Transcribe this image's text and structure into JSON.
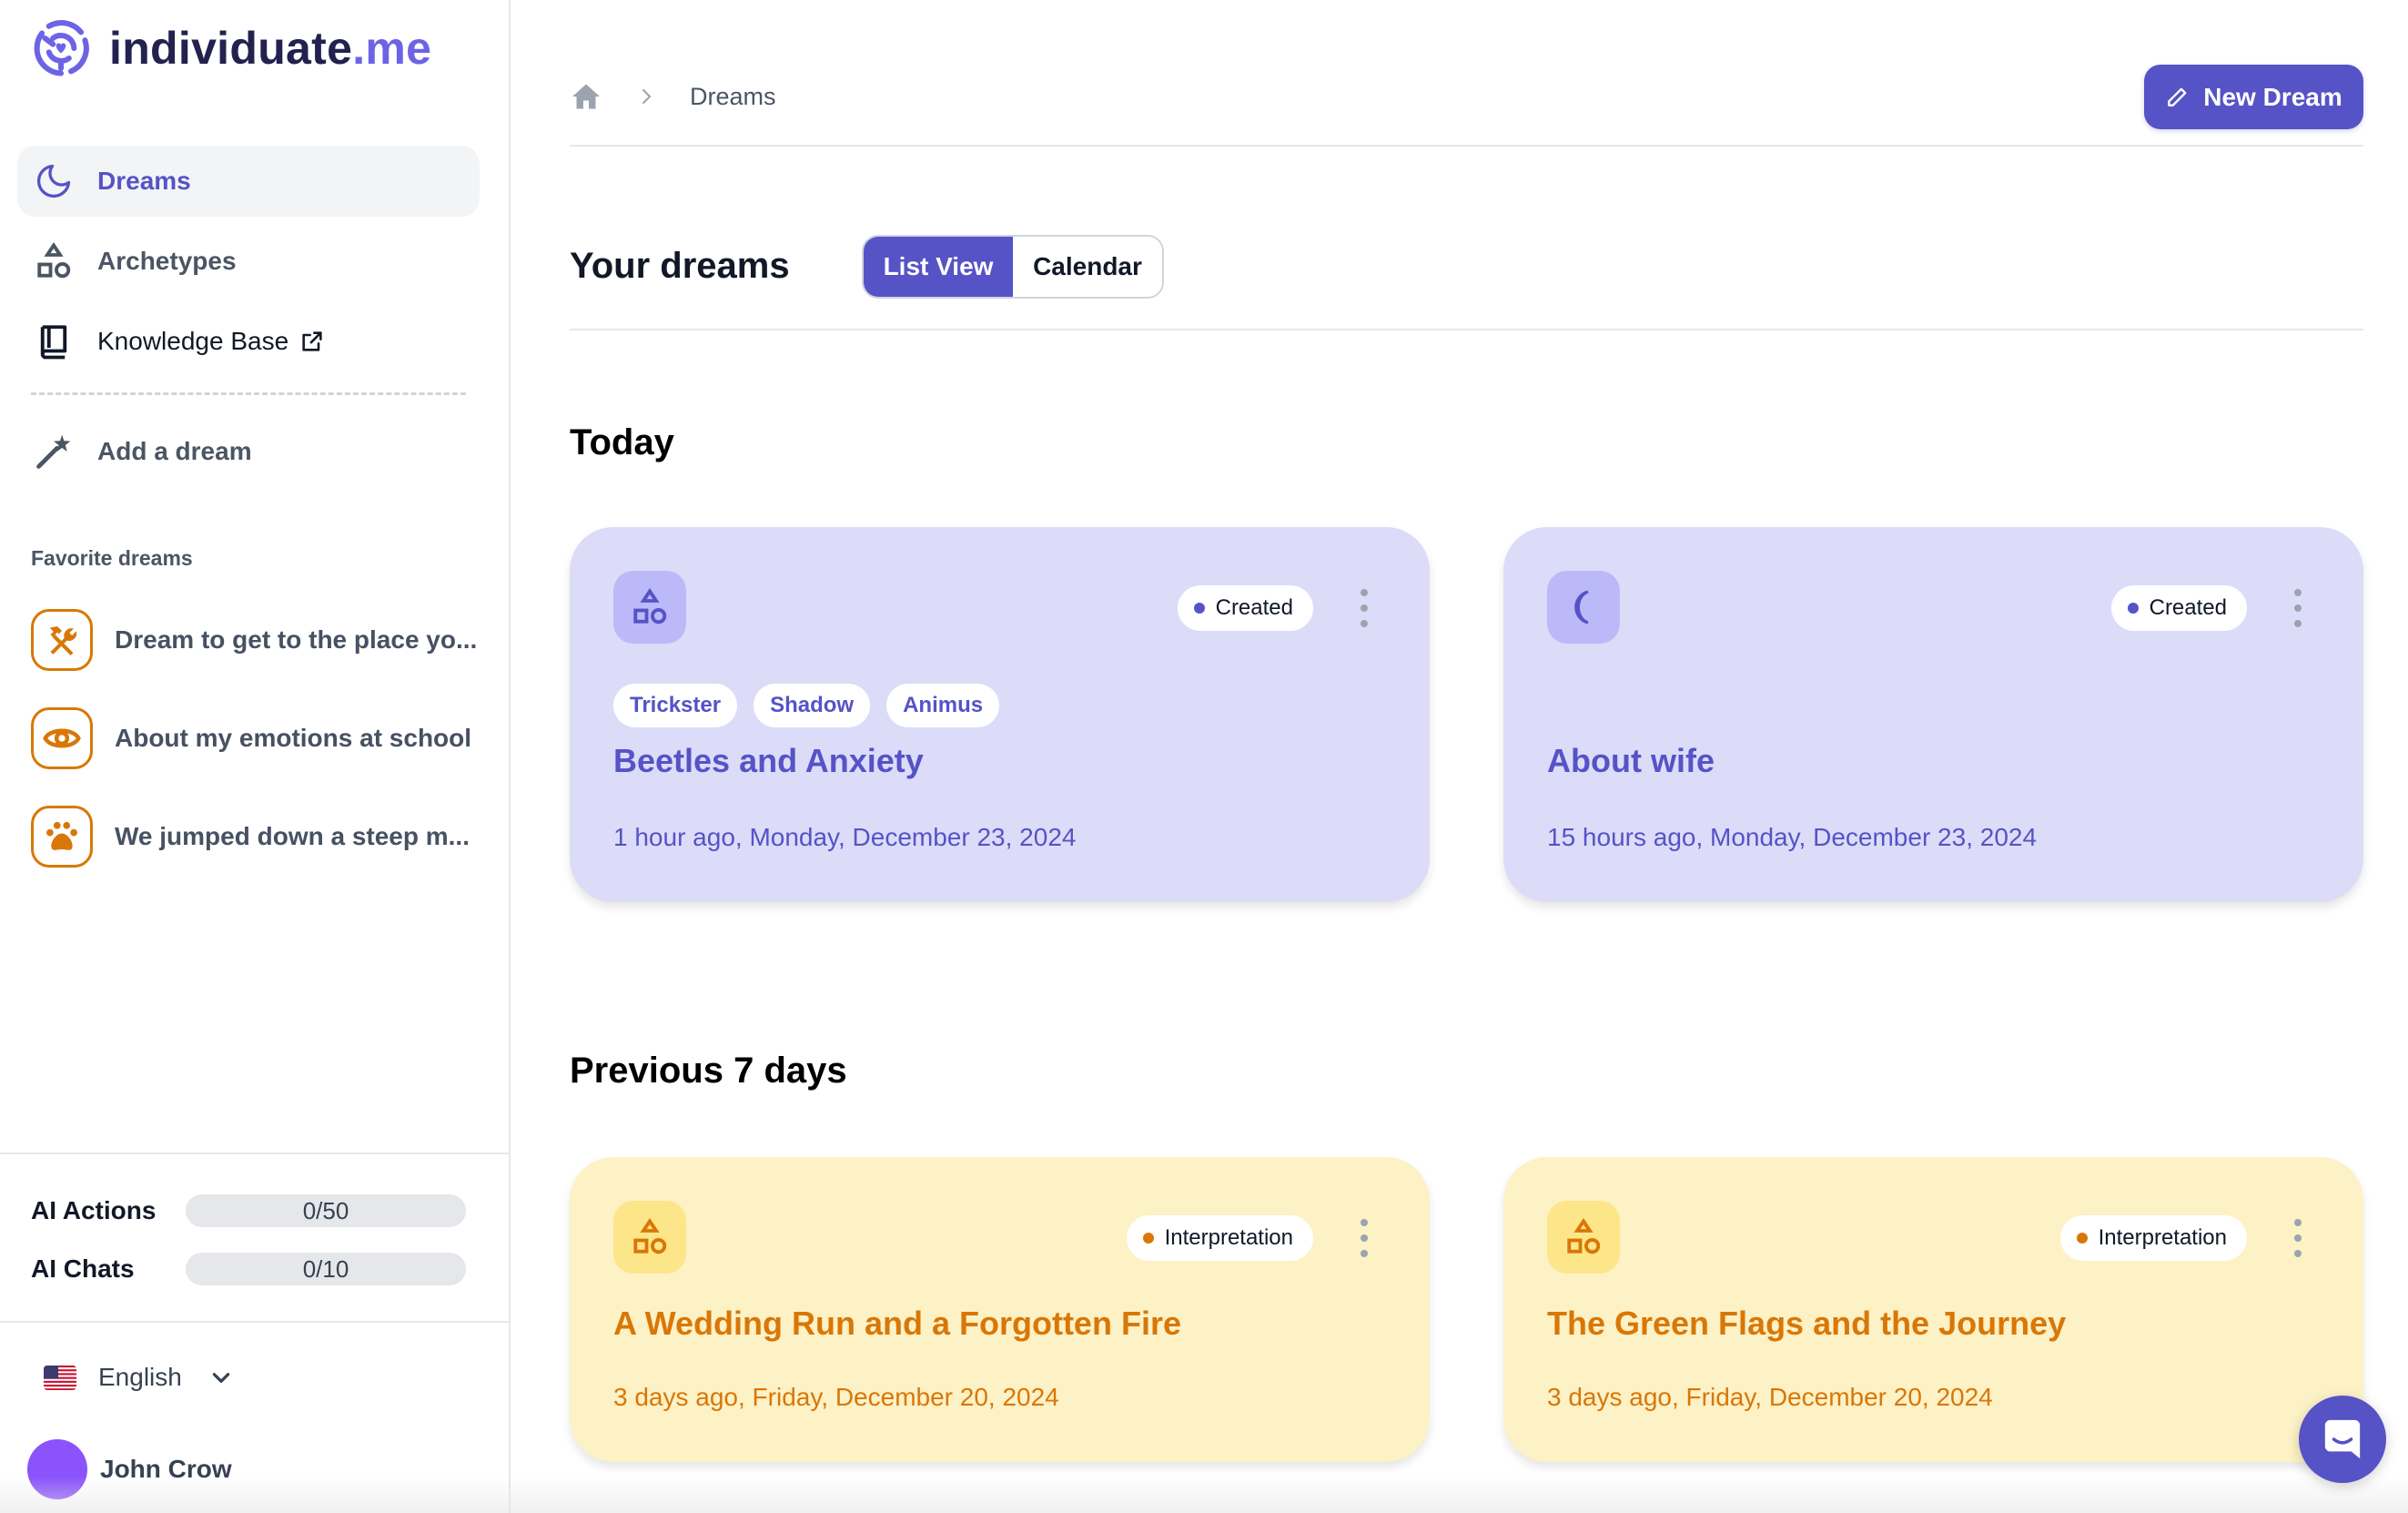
{
  "app": {
    "brand_name": "individuate",
    "brand_suffix": ".me",
    "accent_color": "#5553c6"
  },
  "sidebar": {
    "nav": [
      {
        "label": "Dreams",
        "icon": "moon-icon",
        "active": true
      },
      {
        "label": "Archetypes",
        "icon": "shapes-icon",
        "active": false
      },
      {
        "label": "Knowledge Base",
        "icon": "book-icon",
        "external": true,
        "active": false
      },
      {
        "label": "Add a dream",
        "icon": "magic-wand-icon",
        "active": false
      }
    ],
    "favorites_title": "Favorite dreams",
    "favorites": [
      {
        "label": "Dream to get to the place yo...",
        "icon": "tools-icon"
      },
      {
        "label": "About my emotions at school",
        "icon": "eye-icon"
      },
      {
        "label": "We jumped down a steep m...",
        "icon": "paw-icon"
      }
    ],
    "quotas": [
      {
        "label": "AI Actions",
        "text": "0/50",
        "used": 0,
        "limit": 50
      },
      {
        "label": "AI Chats",
        "text": "0/10",
        "used": 0,
        "limit": 10
      }
    ],
    "language": {
      "label": "English",
      "flag": "us-flag-icon"
    },
    "user": {
      "name": "John Crow",
      "avatar_color": "#8b53fb"
    }
  },
  "header": {
    "breadcrumb": [
      {
        "icon": "home-icon"
      },
      {
        "label": "Dreams"
      }
    ],
    "new_button_label": "New Dream"
  },
  "main": {
    "title": "Your dreams",
    "view_toggle": [
      {
        "label": "List View",
        "selected": true
      },
      {
        "label": "Calendar",
        "selected": false
      }
    ],
    "sections": [
      {
        "title": "Today",
        "cards": [
          {
            "title": "Beetles and Anxiety",
            "date": "1 hour ago, Monday, December 23, 2024",
            "status": "Created",
            "icon": "shapes-icon",
            "tags": [
              "Trickster",
              "Shadow",
              "Animus"
            ],
            "theme": "purple"
          },
          {
            "title": "About wife",
            "date": "15 hours ago, Monday, December 23, 2024",
            "status": "Created",
            "icon": "moon-icon",
            "tags": [],
            "theme": "purple"
          }
        ]
      },
      {
        "title": "Previous 7 days",
        "cards": [
          {
            "title": "A Wedding Run and a Forgotten Fire",
            "date": "3 days ago, Friday, December 20, 2024",
            "status": "Interpretation",
            "icon": "shapes-icon",
            "tags": [],
            "theme": "yellow"
          },
          {
            "title": "The Green Flags and the Journey",
            "date": "3 days ago, Friday, December 20, 2024",
            "status": "Interpretation",
            "icon": "shapes-icon",
            "tags": [],
            "theme": "yellow"
          }
        ]
      }
    ]
  },
  "colors": {
    "created_status": "#5553c6",
    "interpretation_status": "#d97706",
    "purple_card_bg": "#dcdcf9",
    "yellow_card_bg": "#fdf1c6"
  }
}
